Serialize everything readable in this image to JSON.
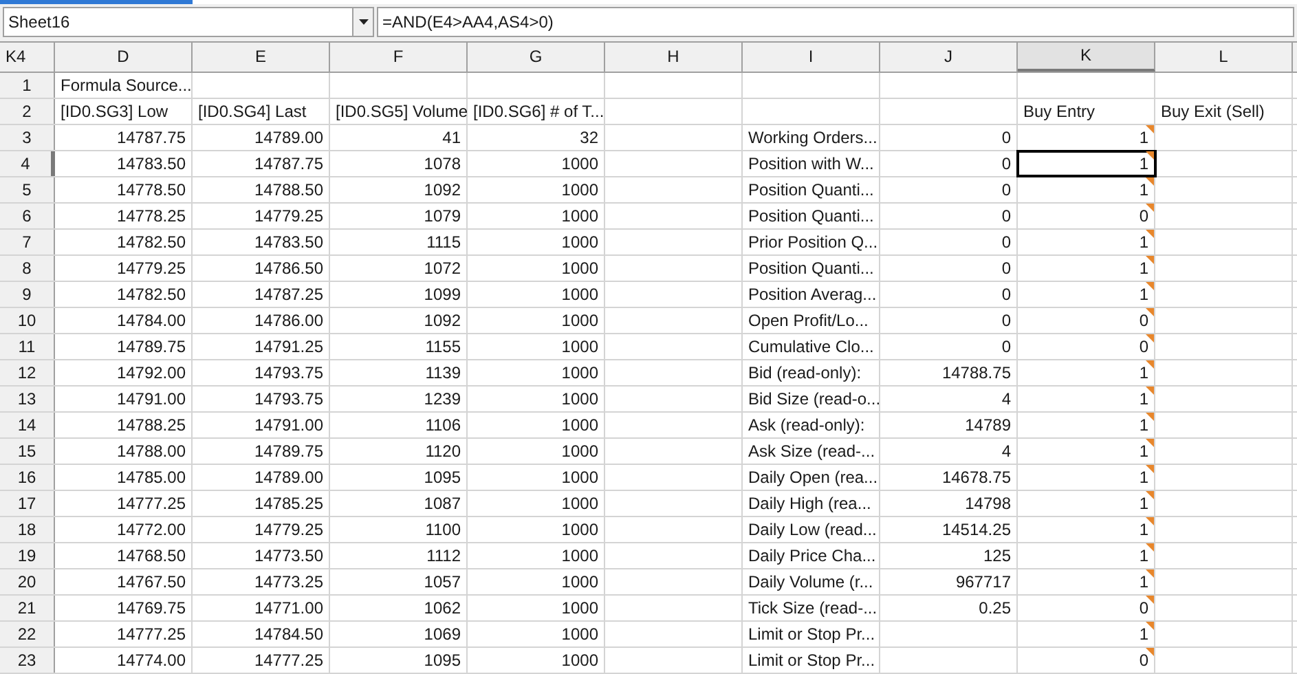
{
  "name_box": {
    "value": "Sheet16"
  },
  "formula_bar": {
    "value": "=AND(E4>AA4,AS4>0)"
  },
  "corner_cell": "K4",
  "columns": [
    {
      "label": "D",
      "selected": false
    },
    {
      "label": "E",
      "selected": false
    },
    {
      "label": "F",
      "selected": false
    },
    {
      "label": "G",
      "selected": false
    },
    {
      "label": "H",
      "selected": false
    },
    {
      "label": "I",
      "selected": false
    },
    {
      "label": "J",
      "selected": false
    },
    {
      "label": "K",
      "selected": true
    },
    {
      "label": "L",
      "selected": false
    }
  ],
  "rows": [
    {
      "number": "1",
      "kind": "header",
      "selected": false,
      "cells": {
        "D": "Formula Source..."
      }
    },
    {
      "number": "2",
      "kind": "header",
      "selected": false,
      "cells": {
        "D": "[ID0.SG3] Low",
        "E": "[ID0.SG4] Last",
        "F": "[ID0.SG5] Volume",
        "G": "[ID0.SG6] # of T...",
        "K": "Buy Entry",
        "L": "Buy Exit (Sell)"
      }
    },
    {
      "number": "3",
      "kind": "data",
      "selected": false,
      "comment": true,
      "cells": {
        "D": "14787.75",
        "E": "14789.00",
        "F": "41",
        "G": "32",
        "I": "Working Orders...",
        "J": "0",
        "K": "1"
      }
    },
    {
      "number": "4",
      "kind": "data",
      "selected": true,
      "comment": true,
      "cells": {
        "D": "14783.50",
        "E": "14787.75",
        "F": "1078",
        "G": "1000",
        "I": "Position with W...",
        "J": "0",
        "K": "1"
      }
    },
    {
      "number": "5",
      "kind": "data",
      "selected": false,
      "comment": true,
      "cells": {
        "D": "14778.50",
        "E": "14788.50",
        "F": "1092",
        "G": "1000",
        "I": "Position Quanti...",
        "J": "0",
        "K": "1"
      }
    },
    {
      "number": "6",
      "kind": "data",
      "selected": false,
      "comment": true,
      "cells": {
        "D": "14778.25",
        "E": "14779.25",
        "F": "1079",
        "G": "1000",
        "I": "Position Quanti...",
        "J": "0",
        "K": "0"
      }
    },
    {
      "number": "7",
      "kind": "data",
      "selected": false,
      "comment": true,
      "cells": {
        "D": "14782.50",
        "E": "14783.50",
        "F": "1115",
        "G": "1000",
        "I": "Prior Position Q...",
        "J": "0",
        "K": "1"
      }
    },
    {
      "number": "8",
      "kind": "data",
      "selected": false,
      "comment": true,
      "cells": {
        "D": "14779.25",
        "E": "14786.50",
        "F": "1072",
        "G": "1000",
        "I": "Position Quanti...",
        "J": "0",
        "K": "1"
      }
    },
    {
      "number": "9",
      "kind": "data",
      "selected": false,
      "comment": true,
      "cells": {
        "D": "14782.50",
        "E": "14787.25",
        "F": "1099",
        "G": "1000",
        "I": "Position Averag...",
        "J": "0",
        "K": "1"
      }
    },
    {
      "number": "10",
      "kind": "data",
      "selected": false,
      "comment": true,
      "cells": {
        "D": "14784.00",
        "E": "14786.00",
        "F": "1092",
        "G": "1000",
        "I": "Open Profit/Lo...",
        "J": "0",
        "K": "0"
      }
    },
    {
      "number": "11",
      "kind": "data",
      "selected": false,
      "comment": true,
      "cells": {
        "D": "14789.75",
        "E": "14791.25",
        "F": "1155",
        "G": "1000",
        "I": "Cumulative Clo...",
        "J": "0",
        "K": "0"
      }
    },
    {
      "number": "12",
      "kind": "data",
      "selected": false,
      "comment": true,
      "cells": {
        "D": "14792.00",
        "E": "14793.75",
        "F": "1139",
        "G": "1000",
        "I": "Bid (read-only):",
        "J": "14788.75",
        "K": "1"
      }
    },
    {
      "number": "13",
      "kind": "data",
      "selected": false,
      "comment": true,
      "cells": {
        "D": "14791.00",
        "E": "14793.75",
        "F": "1239",
        "G": "1000",
        "I": "Bid Size (read-o...",
        "J": "4",
        "K": "1"
      }
    },
    {
      "number": "14",
      "kind": "data",
      "selected": false,
      "comment": true,
      "cells": {
        "D": "14788.25",
        "E": "14791.00",
        "F": "1106",
        "G": "1000",
        "I": "Ask (read-only):",
        "J": "14789",
        "K": "1"
      }
    },
    {
      "number": "15",
      "kind": "data",
      "selected": false,
      "comment": true,
      "cells": {
        "D": "14788.00",
        "E": "14789.75",
        "F": "1120",
        "G": "1000",
        "I": "Ask Size (read-...",
        "J": "4",
        "K": "1"
      }
    },
    {
      "number": "16",
      "kind": "data",
      "selected": false,
      "comment": true,
      "cells": {
        "D": "14785.00",
        "E": "14789.00",
        "F": "1095",
        "G": "1000",
        "I": "Daily Open (rea...",
        "J": "14678.75",
        "K": "1"
      }
    },
    {
      "number": "17",
      "kind": "data",
      "selected": false,
      "comment": true,
      "cells": {
        "D": "14777.25",
        "E": "14785.25",
        "F": "1087",
        "G": "1000",
        "I": "Daily High (rea...",
        "J": "14798",
        "K": "1"
      }
    },
    {
      "number": "18",
      "kind": "data",
      "selected": false,
      "comment": true,
      "cells": {
        "D": "14772.00",
        "E": "14779.25",
        "F": "1100",
        "G": "1000",
        "I": "Daily Low (read...",
        "J": "14514.25",
        "K": "1"
      }
    },
    {
      "number": "19",
      "kind": "data",
      "selected": false,
      "comment": true,
      "cells": {
        "D": "14768.50",
        "E": "14773.50",
        "F": "1112",
        "G": "1000",
        "I": "Daily Price Cha...",
        "J": "125",
        "K": "1"
      }
    },
    {
      "number": "20",
      "kind": "data",
      "selected": false,
      "comment": true,
      "cells": {
        "D": "14767.50",
        "E": "14773.25",
        "F": "1057",
        "G": "1000",
        "I": "Daily Volume (r...",
        "J": "967717",
        "K": "1"
      }
    },
    {
      "number": "21",
      "kind": "data",
      "selected": false,
      "comment": true,
      "cells": {
        "D": "14769.75",
        "E": "14771.00",
        "F": "1062",
        "G": "1000",
        "I": "Tick Size (read-...",
        "J": "0.25",
        "K": "0"
      }
    },
    {
      "number": "22",
      "kind": "data",
      "selected": false,
      "comment": true,
      "cells": {
        "D": "14777.25",
        "E": "14784.50",
        "F": "1069",
        "G": "1000",
        "I": "Limit or Stop Pr...",
        "K": "1"
      }
    },
    {
      "number": "23",
      "kind": "data",
      "selected": false,
      "comment": true,
      "cells": {
        "D": "14774.00",
        "E": "14777.25",
        "F": "1095",
        "G": "1000",
        "I": "Limit or Stop Pr...",
        "K": "0"
      }
    }
  ]
}
